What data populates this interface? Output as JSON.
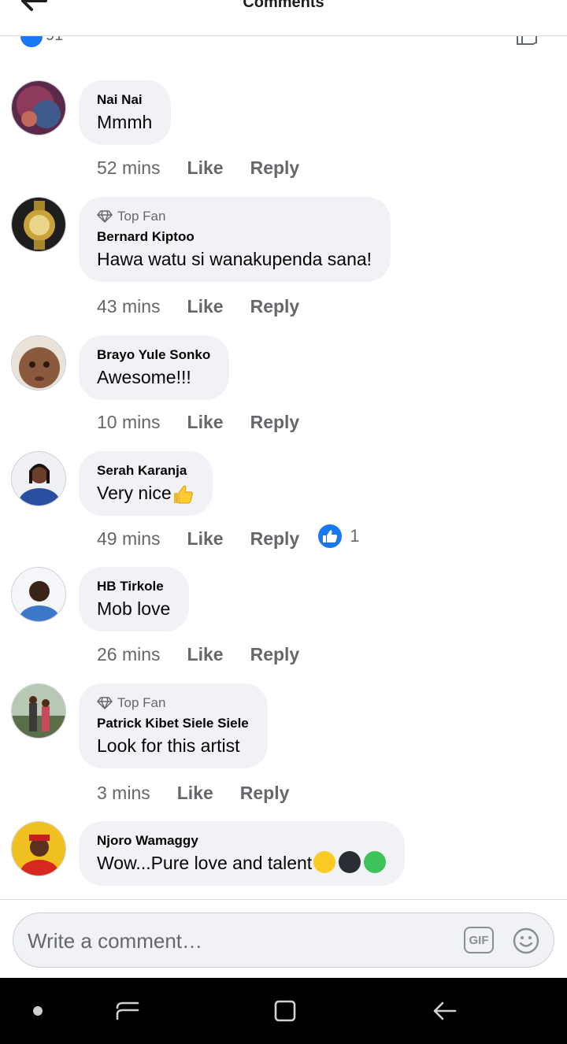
{
  "header": {
    "title": "Comments"
  },
  "reactions": {
    "count": "91"
  },
  "comments": [
    {
      "name": "Nai Nai",
      "top_fan": false,
      "text": "Mmmh",
      "time": "52 mins",
      "like": "Like",
      "reply": "Reply",
      "avatar_color": "#5b2a4a"
    },
    {
      "name": "Bernard Kiptoo",
      "top_fan": true,
      "badge": "Top Fan",
      "text": "Hawa watu si wanakupenda sana!",
      "time": "43 mins",
      "like": "Like",
      "reply": "Reply",
      "avatar_color": "#2a2a2a"
    },
    {
      "name": "Brayo Yule Sonko",
      "top_fan": false,
      "text": "Awesome!!!",
      "time": "10 mins",
      "like": "Like",
      "reply": "Reply",
      "avatar_color": "#8b5a3c"
    },
    {
      "name": "Serah Karanja",
      "top_fan": false,
      "text": "Very nice",
      "time": "49 mins",
      "like": "Like",
      "reply": "Reply",
      "reaction_count": "1",
      "avatar_color": "#2b3f7a"
    },
    {
      "name": "HB Tirkole",
      "top_fan": false,
      "text": "Mob love",
      "time": "26 mins",
      "like": "Like",
      "reply": "Reply",
      "avatar_color": "#3c78c8"
    },
    {
      "name": "Patrick Kibet Siele Siele",
      "top_fan": true,
      "badge": "Top Fan",
      "text": "Look for this artist",
      "time": "3 mins",
      "like": "Like",
      "reply": "Reply",
      "avatar_color": "#5a6e4a"
    },
    {
      "name": "Njoro Wamaggy",
      "top_fan": false,
      "text": "Wow...Pure love and talent",
      "avatar_color": "#e8b020"
    }
  ],
  "composer": {
    "placeholder": "Write a comment…",
    "gif_label": "GIF"
  },
  "colors": {
    "accent": "#1877f2",
    "bubble": "#f0f2f5",
    "muted": "#65676b"
  }
}
